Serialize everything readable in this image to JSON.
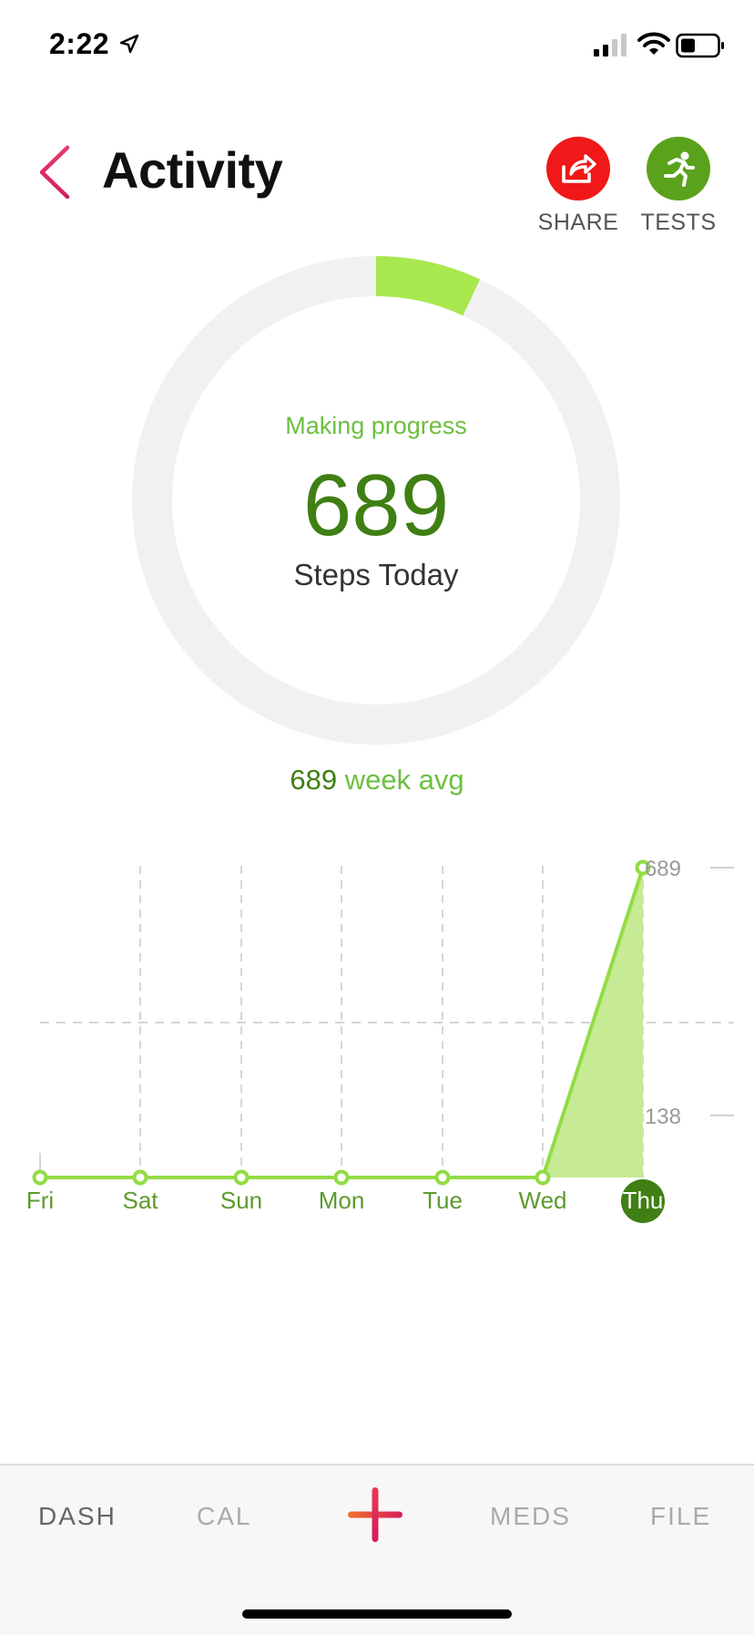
{
  "status_bar": {
    "time": "2:22"
  },
  "header": {
    "title": "Activity",
    "share_label": "SHARE",
    "tests_label": "TESTS"
  },
  "ring": {
    "status": "Making progress",
    "value": "689",
    "caption": "Steps Today",
    "progress_fraction": 0.07
  },
  "week_avg": {
    "value": "689",
    "suffix": " week avg"
  },
  "chart_data": {
    "type": "area",
    "categories": [
      "Fri",
      "Sat",
      "Sun",
      "Mon",
      "Tue",
      "Wed",
      "Thu"
    ],
    "values": [
      0,
      0,
      0,
      0,
      0,
      0,
      689
    ],
    "y_labels": [
      "689",
      "138"
    ],
    "y_label_values": [
      689,
      138
    ],
    "ylim": [
      0,
      689
    ],
    "grid": true,
    "selected": "Thu"
  },
  "nav": {
    "dash": "DASH",
    "cal": "CAL",
    "meds": "MEDS",
    "file": "FILE"
  },
  "colors": {
    "accent_green": "#8fdc4a",
    "dark_green": "#3f7f14",
    "share_red": "#f01818",
    "tests_green": "#5aa21c"
  }
}
